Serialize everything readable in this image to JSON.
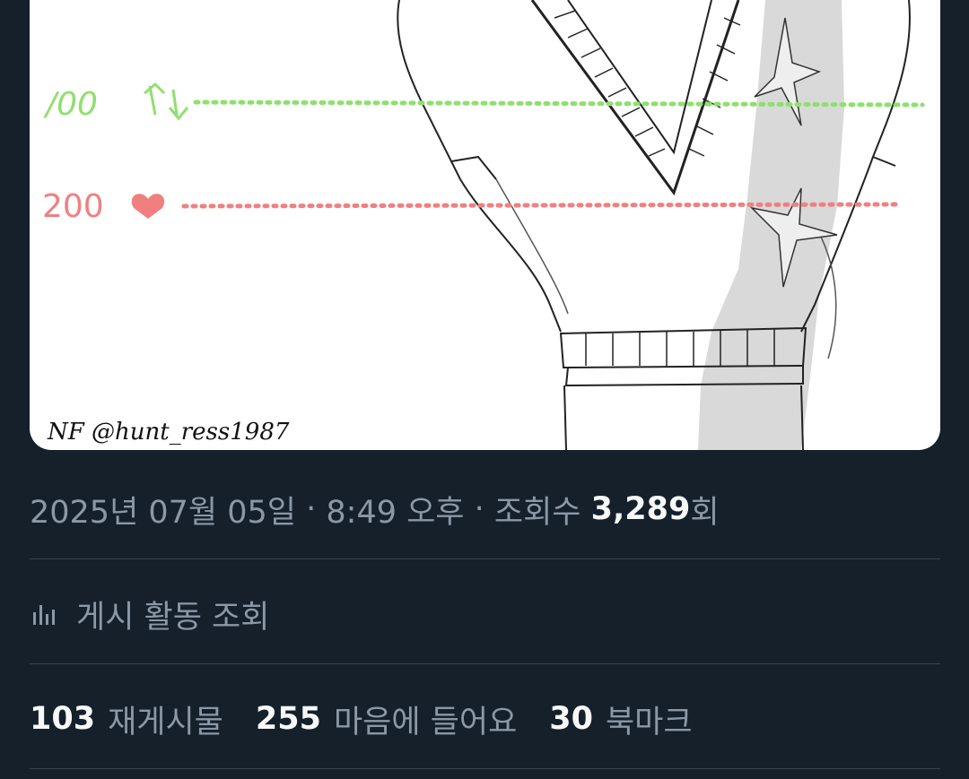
{
  "post": {
    "media": {
      "watermark": "NF @hunt_ress1987",
      "annotations": [
        {
          "value": "100",
          "icon": "retweet-icon",
          "color": "#8ee06e"
        },
        {
          "value": "200",
          "icon": "heart-icon",
          "color": "#f08080"
        }
      ]
    },
    "meta": {
      "date": "2025년 07월 05일",
      "dot1": " · ",
      "time": "8:49 오후",
      "dot2": " · ",
      "views_label": "조회수 ",
      "views_count": "3,289",
      "views_suffix": "회"
    },
    "activity": {
      "icon": "analytics-bar-icon",
      "label": "게시 활동 조회"
    },
    "stats": {
      "reposts": {
        "count": "103",
        "label": "재게시물"
      },
      "likes": {
        "count": "255",
        "label": "마음에 들어요"
      },
      "bookmarks": {
        "count": "30",
        "label": "북마크"
      }
    }
  },
  "colors": {
    "background": "#15202b",
    "text_primary": "#f7f9f9",
    "text_secondary": "#8b98a5",
    "divider": "#38444d"
  }
}
